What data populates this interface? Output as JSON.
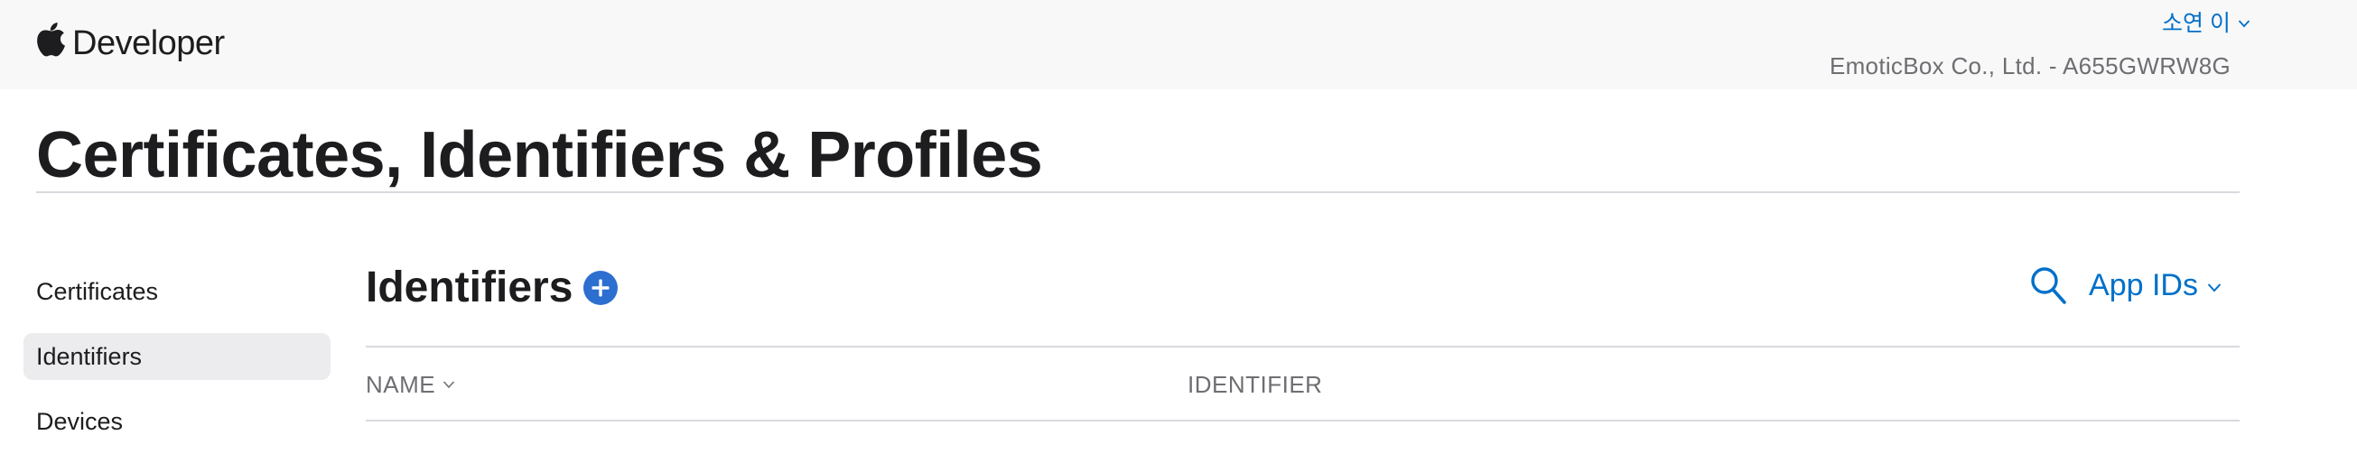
{
  "header": {
    "brand": "Developer",
    "user_name": "소연 이",
    "team": "EmoticBox Co., Ltd. - A655GWRW8G"
  },
  "page": {
    "title": "Certificates, Identifiers & Profiles"
  },
  "sidebar": {
    "items": [
      {
        "label": "Certificates",
        "active": false
      },
      {
        "label": "Identifiers",
        "active": true
      },
      {
        "label": "Devices",
        "active": false
      }
    ]
  },
  "main": {
    "section_title": "Identifiers",
    "filter_label": "App IDs",
    "columns": [
      {
        "label": "NAME",
        "sortable": true
      },
      {
        "label": "IDENTIFIER",
        "sortable": false
      }
    ]
  },
  "icons": {
    "brand": "apple-logo-icon",
    "add": "plus-circle-icon",
    "search": "search-icon",
    "dropdown": "chevron-down-icon"
  },
  "colors": {
    "accent": "#0070c9",
    "add_button": "#2d6fd0",
    "header_bg": "#f8f8f8",
    "active_nav_bg": "#ececee"
  }
}
